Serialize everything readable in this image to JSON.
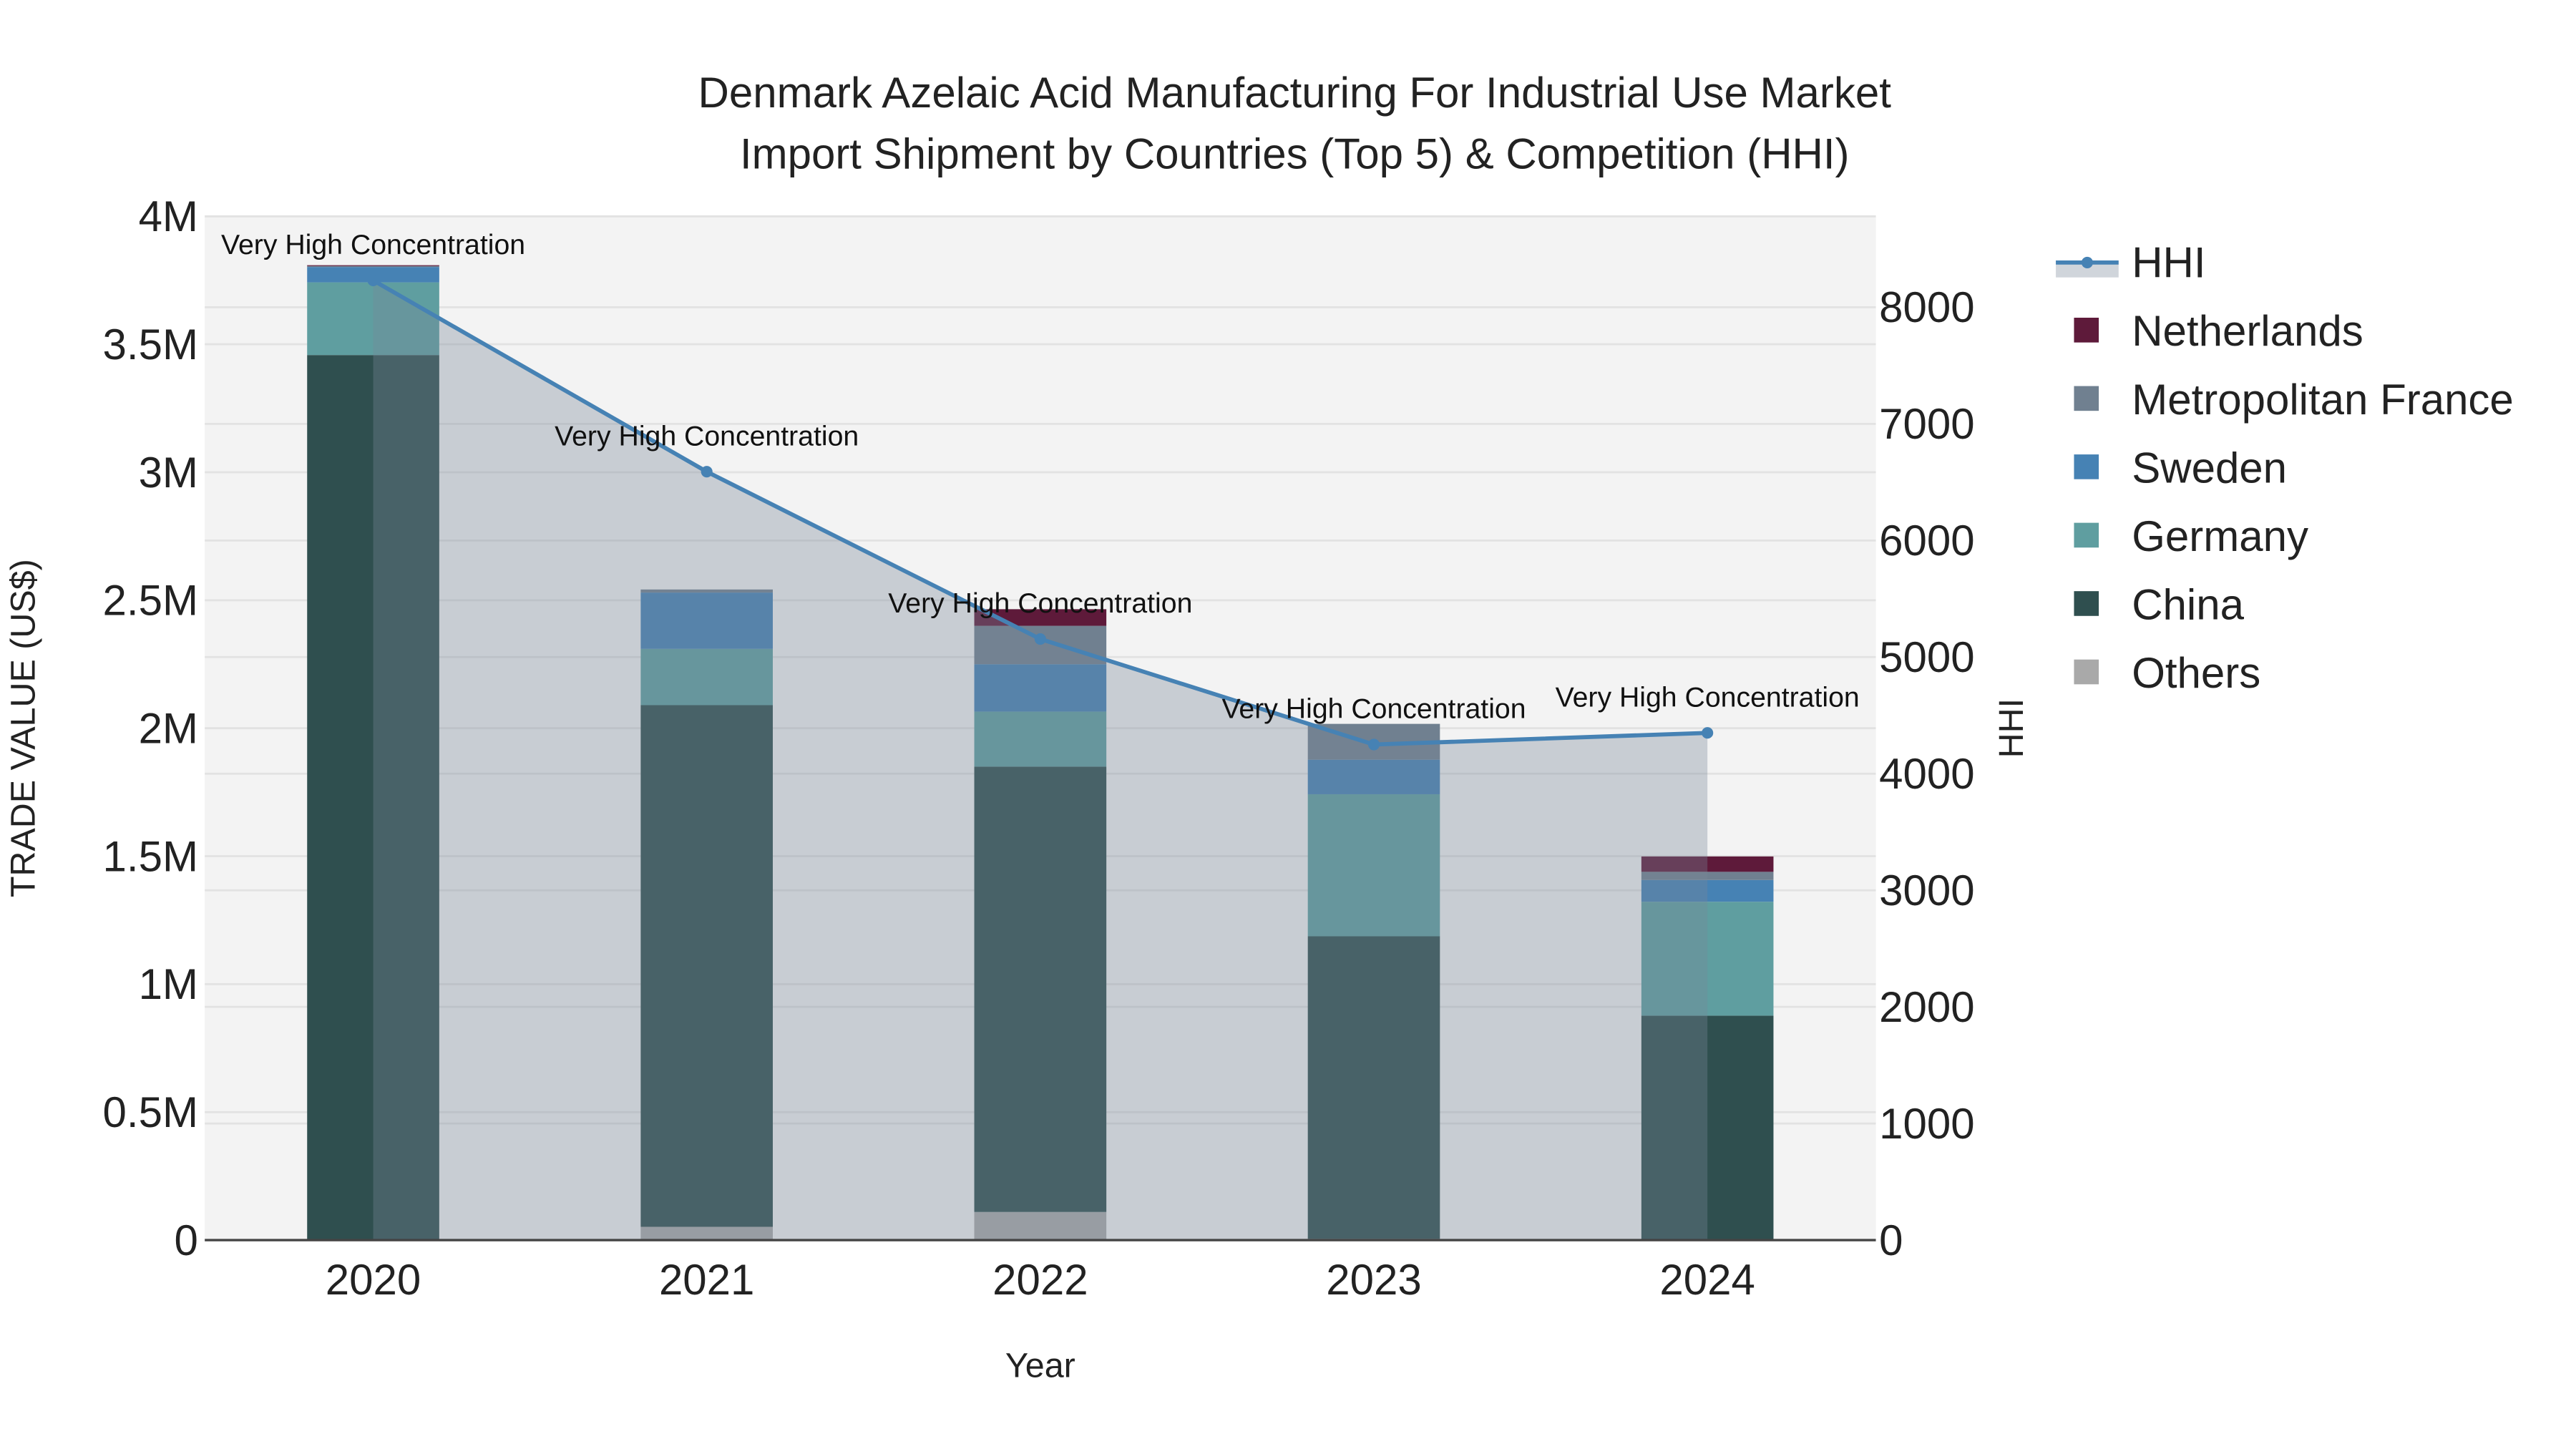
{
  "chart_data": {
    "type": "bar",
    "title_line1": "Denmark Azelaic Acid Manufacturing For Industrial Use Market",
    "title_line2": "Import Shipment by Countries (Top 5) & Competition (HHI)",
    "xlabel": "Year",
    "ylabel": "TRADE VALUE (US$)",
    "y2label": "HHI",
    "categories": [
      "2020",
      "2021",
      "2022",
      "2023",
      "2024"
    ],
    "ylim": [
      0,
      4000000
    ],
    "y_ticks": [
      {
        "v": 0,
        "label": "0"
      },
      {
        "v": 500000,
        "label": "0.5M"
      },
      {
        "v": 1000000,
        "label": "1M"
      },
      {
        "v": 1500000,
        "label": "1.5M"
      },
      {
        "v": 2000000,
        "label": "2M"
      },
      {
        "v": 2500000,
        "label": "2.5M"
      },
      {
        "v": 3000000,
        "label": "3M"
      },
      {
        "v": 3500000,
        "label": "3.5M"
      },
      {
        "v": 4000000,
        "label": "4M"
      }
    ],
    "y2lim": [
      0,
      8780
    ],
    "y2_ticks": [
      {
        "v": 0,
        "label": "0"
      },
      {
        "v": 1000,
        "label": "1000"
      },
      {
        "v": 2000,
        "label": "2000"
      },
      {
        "v": 3000,
        "label": "3000"
      },
      {
        "v": 4000,
        "label": "4000"
      },
      {
        "v": 5000,
        "label": "5000"
      },
      {
        "v": 6000,
        "label": "6000"
      },
      {
        "v": 7000,
        "label": "7000"
      },
      {
        "v": 8000,
        "label": "8000"
      }
    ],
    "series": [
      {
        "name": "Others",
        "color": "#a9a9a9",
        "values": [
          0,
          52000,
          110000,
          5000,
          0
        ]
      },
      {
        "name": "China",
        "color": "#2f4f4f",
        "values": [
          3458000,
          2038000,
          1740000,
          1182000,
          877000
        ]
      },
      {
        "name": "Germany",
        "color": "#5f9ea0",
        "values": [
          284000,
          220000,
          215000,
          555000,
          445000
        ]
      },
      {
        "name": "Sweden",
        "color": "#4682b4",
        "values": [
          60000,
          220000,
          185000,
          135000,
          85000
        ]
      },
      {
        "name": "Metropolitan France",
        "color": "#708090",
        "values": [
          4000,
          12000,
          150000,
          140000,
          32000
        ]
      },
      {
        "name": "Netherlands",
        "color": "#5e1a3a",
        "values": [
          3000,
          0,
          65000,
          0,
          60000
        ]
      }
    ],
    "hhi": {
      "name": "HHI",
      "color": "#4682b4",
      "values": [
        8230,
        6590,
        5155,
        4250,
        4350
      ],
      "annotations": [
        "Very High Concentration",
        "Very High Concentration",
        "Very High Concentration",
        "Very High Concentration",
        "Very High Concentration"
      ]
    },
    "legend_order": [
      "HHI",
      "Netherlands",
      "Metropolitan France",
      "Sweden",
      "Germany",
      "China",
      "Others"
    ],
    "legend_placement": "right",
    "grid": true
  }
}
